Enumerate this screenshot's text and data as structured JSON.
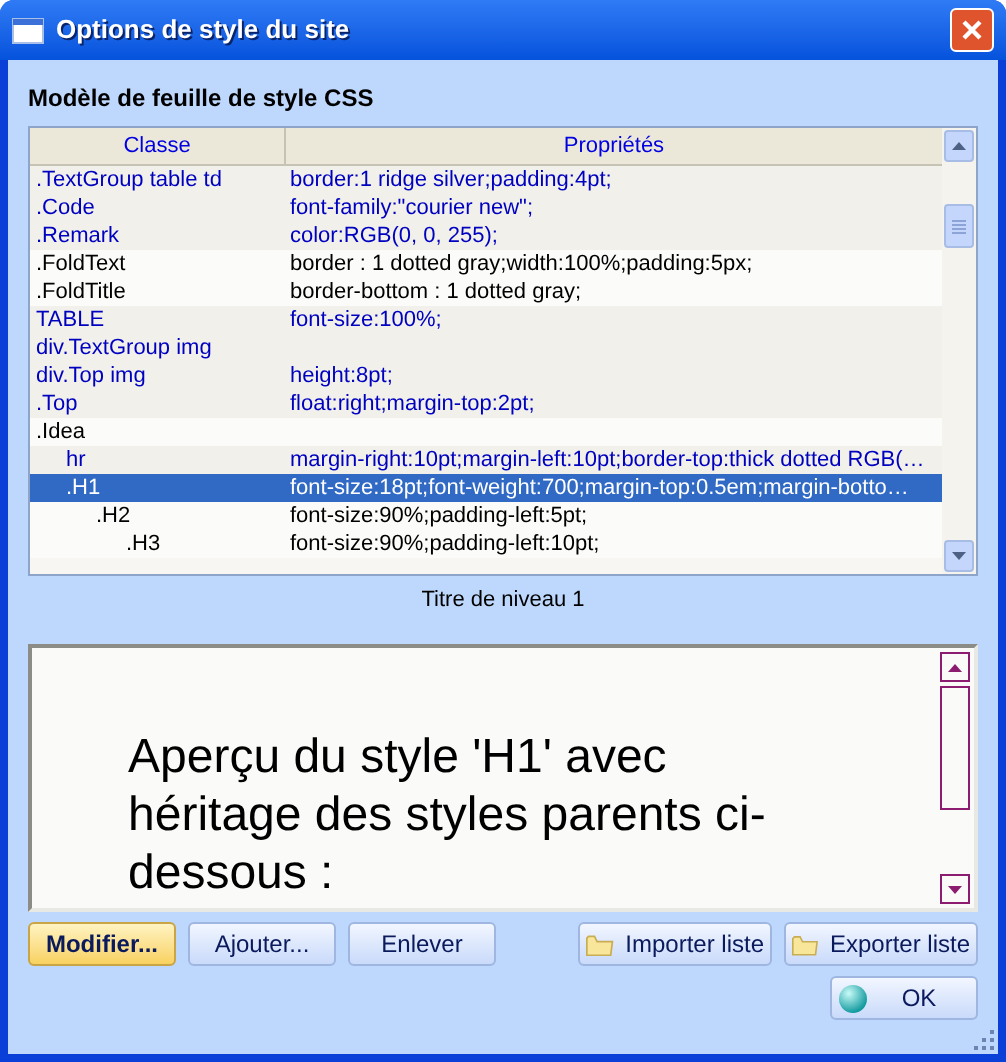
{
  "window": {
    "title": "Options de style du site"
  },
  "section_title": "Modèle de feuille de style CSS",
  "table": {
    "columns": [
      "Classe",
      "Propriétés"
    ],
    "rows": [
      {
        "classe": ".TextGroup table td",
        "props": "border:1 ridge silver;padding:4pt;",
        "color": "#0000c0",
        "shaded": true,
        "selected": false
      },
      {
        "classe": ".Code",
        "props": "font-family:\"courier new\";",
        "color": "#0000c0",
        "shaded": true,
        "selected": false
      },
      {
        "classe": ".Remark",
        "props": "color:RGB(0, 0, 255);",
        "color": "#0000c0",
        "shaded": true,
        "selected": false
      },
      {
        "classe": ".FoldText",
        "props": "border : 1 dotted gray;width:100%;padding:5px;",
        "color": "#000000",
        "shaded": false,
        "selected": false
      },
      {
        "classe": ".FoldTitle",
        "props": "border-bottom : 1 dotted gray;",
        "color": "#000000",
        "shaded": false,
        "selected": false
      },
      {
        "classe": "TABLE",
        "props": "font-size:100%;",
        "color": "#0000c0",
        "shaded": true,
        "selected": false
      },
      {
        "classe": "div.TextGroup img",
        "props": "",
        "color": "#0000c0",
        "shaded": true,
        "selected": false
      },
      {
        "classe": "div.Top img",
        "props": "height:8pt;",
        "color": "#0000c0",
        "shaded": true,
        "selected": false
      },
      {
        "classe": ".Top",
        "props": "float:right;margin-top:2pt;",
        "color": "#0000c0",
        "shaded": true,
        "selected": false
      },
      {
        "classe": ".Idea",
        "props": "",
        "color": "#000000",
        "shaded": false,
        "selected": false,
        "children": [
          {
            "classe": "hr",
            "props": "margin-right:10pt;margin-left:10pt;border-top:thick dotted RGB(…",
            "color": "#0000c0",
            "shaded": true,
            "selected": false
          },
          {
            "classe": ".H1",
            "props": "font-size:18pt;font-weight:700;margin-top:0.5em;margin-botto…",
            "shaded": false,
            "selected": true,
            "children": [
              {
                "classe": ".H2",
                "props": "font-size:90%;padding-left:5pt;",
                "color": "#000000",
                "shaded": false,
                "selected": false,
                "children": [
                  {
                    "classe": ".H3",
                    "props": "font-size:90%;padding-left:10pt;",
                    "color": "#000000",
                    "shaded": false,
                    "selected": false
                  }
                ]
              }
            ]
          }
        ]
      }
    ]
  },
  "description": "Titre de niveau 1",
  "preview": {
    "text": "Aperçu du style 'H1' avec héritage des styles parents ci-dessous :"
  },
  "buttons_left": [
    {
      "label": "Modifier...",
      "default": true
    },
    {
      "label": "Ajouter...",
      "default": false
    },
    {
      "label": "Enlever",
      "default": false
    }
  ],
  "buttons_right": [
    {
      "label": "Importer liste"
    },
    {
      "label": "Exporter liste"
    }
  ],
  "ok_button": {
    "label": "OK"
  }
}
